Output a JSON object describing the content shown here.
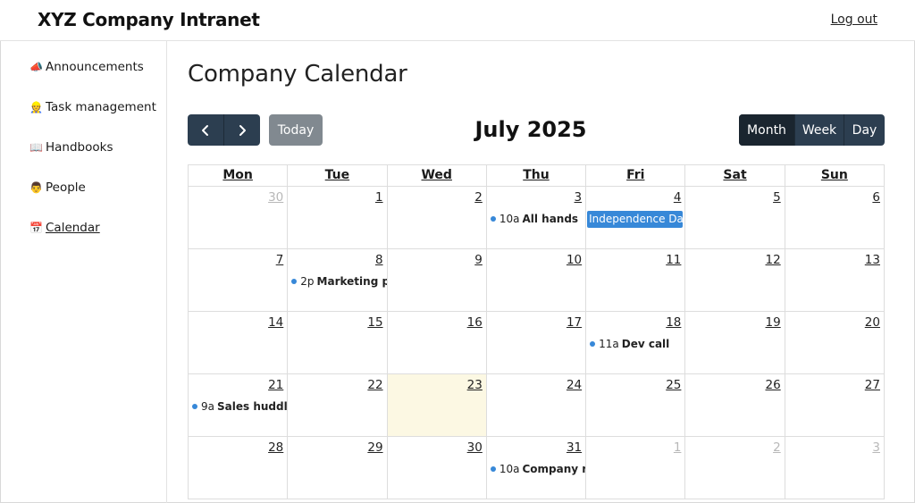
{
  "header": {
    "brand": "XYZ Company Intranet",
    "logout": "Log out"
  },
  "sidebar": {
    "items": [
      {
        "emoji": "📣",
        "label": "Announcements"
      },
      {
        "emoji": "👷",
        "label": "Task management"
      },
      {
        "emoji": "📖",
        "label": "Handbooks"
      },
      {
        "emoji": "👨",
        "label": "People"
      },
      {
        "emoji": "📅",
        "label": "Calendar",
        "active": true
      }
    ]
  },
  "main": {
    "title": "Company Calendar"
  },
  "toolbar": {
    "prev_icon": "chevron-left-icon",
    "next_icon": "chevron-right-icon",
    "today_label": "Today",
    "period_title": "July 2025",
    "views": [
      "Month",
      "Week",
      "Day"
    ],
    "active_view": "Month"
  },
  "calendar": {
    "weekdays": [
      "Mon",
      "Tue",
      "Wed",
      "Thu",
      "Fri",
      "Sat",
      "Sun"
    ],
    "today_date": "23",
    "event_color": "#3788d8",
    "weeks": [
      [
        {
          "day": "30",
          "other": true
        },
        {
          "day": "1"
        },
        {
          "day": "2"
        },
        {
          "day": "3",
          "event": {
            "time": "10a",
            "title": "All hands"
          }
        },
        {
          "day": "4",
          "allday": "Independence Day"
        },
        {
          "day": "5"
        },
        {
          "day": "6"
        }
      ],
      [
        {
          "day": "7"
        },
        {
          "day": "8",
          "event": {
            "time": "2p",
            "title": "Marketing pla"
          }
        },
        {
          "day": "9"
        },
        {
          "day": "10"
        },
        {
          "day": "11"
        },
        {
          "day": "12"
        },
        {
          "day": "13"
        }
      ],
      [
        {
          "day": "14"
        },
        {
          "day": "15"
        },
        {
          "day": "16"
        },
        {
          "day": "17"
        },
        {
          "day": "18",
          "event": {
            "time": "11a",
            "title": "Dev call"
          }
        },
        {
          "day": "19"
        },
        {
          "day": "20"
        }
      ],
      [
        {
          "day": "21",
          "event": {
            "time": "9a",
            "title": "Sales huddle"
          }
        },
        {
          "day": "22"
        },
        {
          "day": "23",
          "today": true
        },
        {
          "day": "24"
        },
        {
          "day": "25"
        },
        {
          "day": "26"
        },
        {
          "day": "27"
        }
      ],
      [
        {
          "day": "28"
        },
        {
          "day": "29"
        },
        {
          "day": "30"
        },
        {
          "day": "31",
          "event": {
            "time": "10a",
            "title": "Company ret"
          }
        },
        {
          "day": "1",
          "other": true
        },
        {
          "day": "2",
          "other": true
        },
        {
          "day": "3",
          "other": true
        }
      ]
    ]
  }
}
